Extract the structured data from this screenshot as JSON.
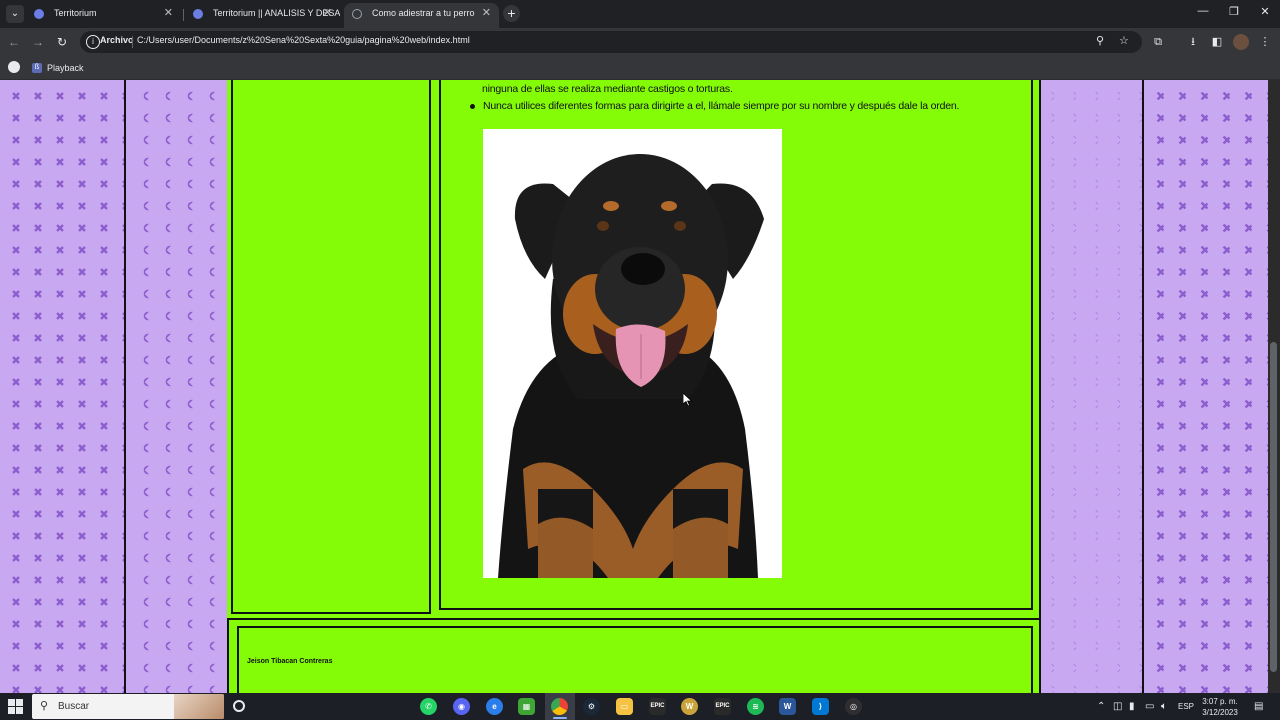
{
  "browser": {
    "tabs": [
      {
        "title": "Territorium",
        "active": false,
        "favicon_color": "#6b7ee6"
      },
      {
        "title": "Territorium || ANALISIS Y DESA",
        "active": false,
        "favicon_color": "#6b7ee6"
      },
      {
        "title": "Como adiestrar a tu perro",
        "active": true,
        "favicon_color": "#9aa0a6"
      }
    ],
    "new_tab_label": "+",
    "url_scheme_label": "Archivo",
    "url": "C:/Users/user/Documents/z%20Sena%20Sexta%20guia/pagina%20web/index.html",
    "bookmarks": [
      {
        "label": "Playback",
        "favicon_letter": "ß"
      }
    ]
  },
  "page": {
    "list_items": [
      "ninguna de ellas se realiza mediante castigos o torturas.",
      "Nunca utilices diferentes formas para dirigirte a el, llámale siempre por su nombre y después dale la orden."
    ],
    "image_subject": "rottweiler-dog",
    "footer_author": "Jeison Tibacan Contreras",
    "colors": {
      "green_panel": "#84fc08",
      "purple_pattern": "#c9a8f2",
      "pattern_cross": "#8d5fcf",
      "border": "#111111"
    }
  },
  "taskbar": {
    "search_placeholder": "Buscar",
    "language": "ESP",
    "time": "3:07 p. m.",
    "date": "3/12/2023",
    "apps": [
      "whatsapp",
      "discord",
      "edge-dev",
      "minecraft",
      "chrome",
      "steam",
      "file-explorer",
      "epic-games",
      "wow",
      "epic-games-2",
      "spotify",
      "word",
      "vscode",
      "obs"
    ]
  }
}
